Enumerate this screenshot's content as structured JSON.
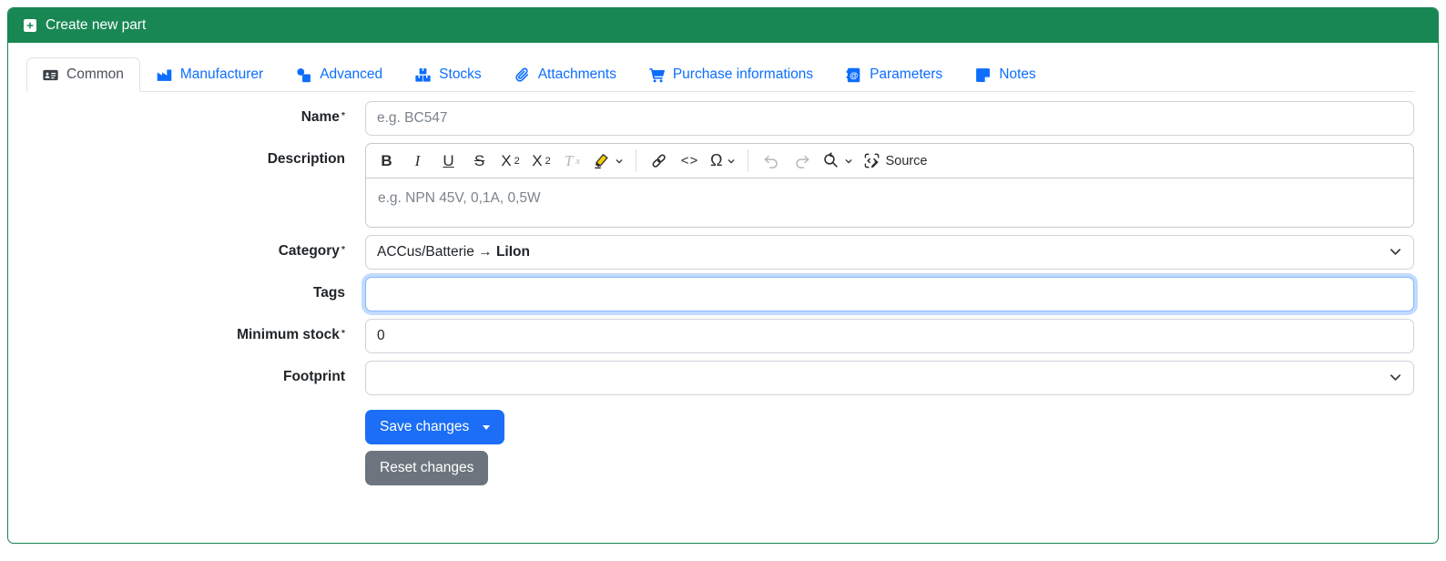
{
  "header": {
    "title": "Create new part"
  },
  "tabs": [
    {
      "label": "Common",
      "active": true
    },
    {
      "label": "Manufacturer"
    },
    {
      "label": "Advanced"
    },
    {
      "label": "Stocks"
    },
    {
      "label": "Attachments"
    },
    {
      "label": "Purchase informations"
    },
    {
      "label": "Parameters"
    },
    {
      "label": "Notes"
    }
  ],
  "form": {
    "required_marker": "*",
    "name": {
      "label": "Name",
      "placeholder": "e.g. BC547",
      "value": ""
    },
    "description": {
      "label": "Description",
      "placeholder": "e.g. NPN 45V, 0,1A, 0,5W",
      "value": "",
      "toolbar": {
        "bold": "B",
        "italic": "I",
        "underline": "U",
        "strikethrough": "S",
        "subscript_base": "X",
        "subscript_script": "2",
        "superscript_base": "X",
        "superscript_script": "2",
        "remove_format_base": "T",
        "remove_format_script": "x",
        "code": "<>",
        "special_characters": "Ω",
        "source_label": "Source"
      }
    },
    "category": {
      "label": "Category",
      "value_prefix": "ACCus/Batterie → ",
      "value_bold": "LiIon"
    },
    "tags": {
      "label": "Tags",
      "value": "",
      "focused": true
    },
    "minimum_stock": {
      "label": "Minimum stock",
      "value": "0"
    },
    "footprint": {
      "label": "Footprint",
      "value": ""
    }
  },
  "buttons": {
    "save": "Save changes",
    "reset": "Reset changes"
  },
  "colors": {
    "header_green": "#198754",
    "tab_link_blue": "#0d6efd",
    "save_blue": "#1b6ef5",
    "reset_gray": "#6c757d",
    "focus_ring": "#86b7fe",
    "highlighter_yellow": "#f6d000"
  }
}
